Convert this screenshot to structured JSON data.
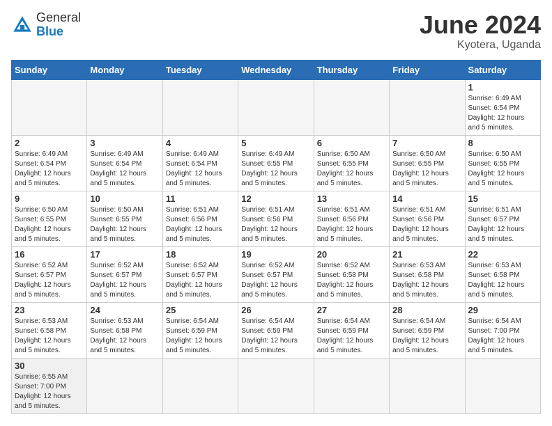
{
  "header": {
    "logo_general": "General",
    "logo_blue": "Blue",
    "month_year": "June 2024",
    "location": "Kyotera, Uganda"
  },
  "weekdays": [
    "Sunday",
    "Monday",
    "Tuesday",
    "Wednesday",
    "Thursday",
    "Friday",
    "Saturday"
  ],
  "weeks": [
    [
      {
        "day": "",
        "info": ""
      },
      {
        "day": "",
        "info": ""
      },
      {
        "day": "",
        "info": ""
      },
      {
        "day": "",
        "info": ""
      },
      {
        "day": "",
        "info": ""
      },
      {
        "day": "",
        "info": ""
      },
      {
        "day": "1",
        "info": "Sunrise: 6:49 AM\nSunset: 6:54 PM\nDaylight: 12 hours and 5 minutes."
      }
    ],
    [
      {
        "day": "2",
        "info": "Sunrise: 6:49 AM\nSunset: 6:54 PM\nDaylight: 12 hours and 5 minutes."
      },
      {
        "day": "3",
        "info": "Sunrise: 6:49 AM\nSunset: 6:54 PM\nDaylight: 12 hours and 5 minutes."
      },
      {
        "day": "4",
        "info": "Sunrise: 6:49 AM\nSunset: 6:54 PM\nDaylight: 12 hours and 5 minutes."
      },
      {
        "day": "5",
        "info": "Sunrise: 6:49 AM\nSunset: 6:55 PM\nDaylight: 12 hours and 5 minutes."
      },
      {
        "day": "6",
        "info": "Sunrise: 6:50 AM\nSunset: 6:55 PM\nDaylight: 12 hours and 5 minutes."
      },
      {
        "day": "7",
        "info": "Sunrise: 6:50 AM\nSunset: 6:55 PM\nDaylight: 12 hours and 5 minutes."
      },
      {
        "day": "8",
        "info": "Sunrise: 6:50 AM\nSunset: 6:55 PM\nDaylight: 12 hours and 5 minutes."
      }
    ],
    [
      {
        "day": "9",
        "info": "Sunrise: 6:50 AM\nSunset: 6:55 PM\nDaylight: 12 hours and 5 minutes."
      },
      {
        "day": "10",
        "info": "Sunrise: 6:50 AM\nSunset: 6:55 PM\nDaylight: 12 hours and 5 minutes."
      },
      {
        "day": "11",
        "info": "Sunrise: 6:51 AM\nSunset: 6:56 PM\nDaylight: 12 hours and 5 minutes."
      },
      {
        "day": "12",
        "info": "Sunrise: 6:51 AM\nSunset: 6:56 PM\nDaylight: 12 hours and 5 minutes."
      },
      {
        "day": "13",
        "info": "Sunrise: 6:51 AM\nSunset: 6:56 PM\nDaylight: 12 hours and 5 minutes."
      },
      {
        "day": "14",
        "info": "Sunrise: 6:51 AM\nSunset: 6:56 PM\nDaylight: 12 hours and 5 minutes."
      },
      {
        "day": "15",
        "info": "Sunrise: 6:51 AM\nSunset: 6:57 PM\nDaylight: 12 hours and 5 minutes."
      }
    ],
    [
      {
        "day": "16",
        "info": "Sunrise: 6:52 AM\nSunset: 6:57 PM\nDaylight: 12 hours and 5 minutes."
      },
      {
        "day": "17",
        "info": "Sunrise: 6:52 AM\nSunset: 6:57 PM\nDaylight: 12 hours and 5 minutes."
      },
      {
        "day": "18",
        "info": "Sunrise: 6:52 AM\nSunset: 6:57 PM\nDaylight: 12 hours and 5 minutes."
      },
      {
        "day": "19",
        "info": "Sunrise: 6:52 AM\nSunset: 6:57 PM\nDaylight: 12 hours and 5 minutes."
      },
      {
        "day": "20",
        "info": "Sunrise: 6:52 AM\nSunset: 6:58 PM\nDaylight: 12 hours and 5 minutes."
      },
      {
        "day": "21",
        "info": "Sunrise: 6:53 AM\nSunset: 6:58 PM\nDaylight: 12 hours and 5 minutes."
      },
      {
        "day": "22",
        "info": "Sunrise: 6:53 AM\nSunset: 6:58 PM\nDaylight: 12 hours and 5 minutes."
      }
    ],
    [
      {
        "day": "23",
        "info": "Sunrise: 6:53 AM\nSunset: 6:58 PM\nDaylight: 12 hours and 5 minutes."
      },
      {
        "day": "24",
        "info": "Sunrise: 6:53 AM\nSunset: 6:58 PM\nDaylight: 12 hours and 5 minutes."
      },
      {
        "day": "25",
        "info": "Sunrise: 6:54 AM\nSunset: 6:59 PM\nDaylight: 12 hours and 5 minutes."
      },
      {
        "day": "26",
        "info": "Sunrise: 6:54 AM\nSunset: 6:59 PM\nDaylight: 12 hours and 5 minutes."
      },
      {
        "day": "27",
        "info": "Sunrise: 6:54 AM\nSunset: 6:59 PM\nDaylight: 12 hours and 5 minutes."
      },
      {
        "day": "28",
        "info": "Sunrise: 6:54 AM\nSunset: 6:59 PM\nDaylight: 12 hours and 5 minutes."
      },
      {
        "day": "29",
        "info": "Sunrise: 6:54 AM\nSunset: 7:00 PM\nDaylight: 12 hours and 5 minutes."
      }
    ],
    [
      {
        "day": "30",
        "info": "Sunrise: 6:55 AM\nSunset: 7:00 PM\nDaylight: 12 hours and 5 minutes."
      },
      {
        "day": "",
        "info": ""
      },
      {
        "day": "",
        "info": ""
      },
      {
        "day": "",
        "info": ""
      },
      {
        "day": "",
        "info": ""
      },
      {
        "day": "",
        "info": ""
      },
      {
        "day": "",
        "info": ""
      }
    ]
  ]
}
